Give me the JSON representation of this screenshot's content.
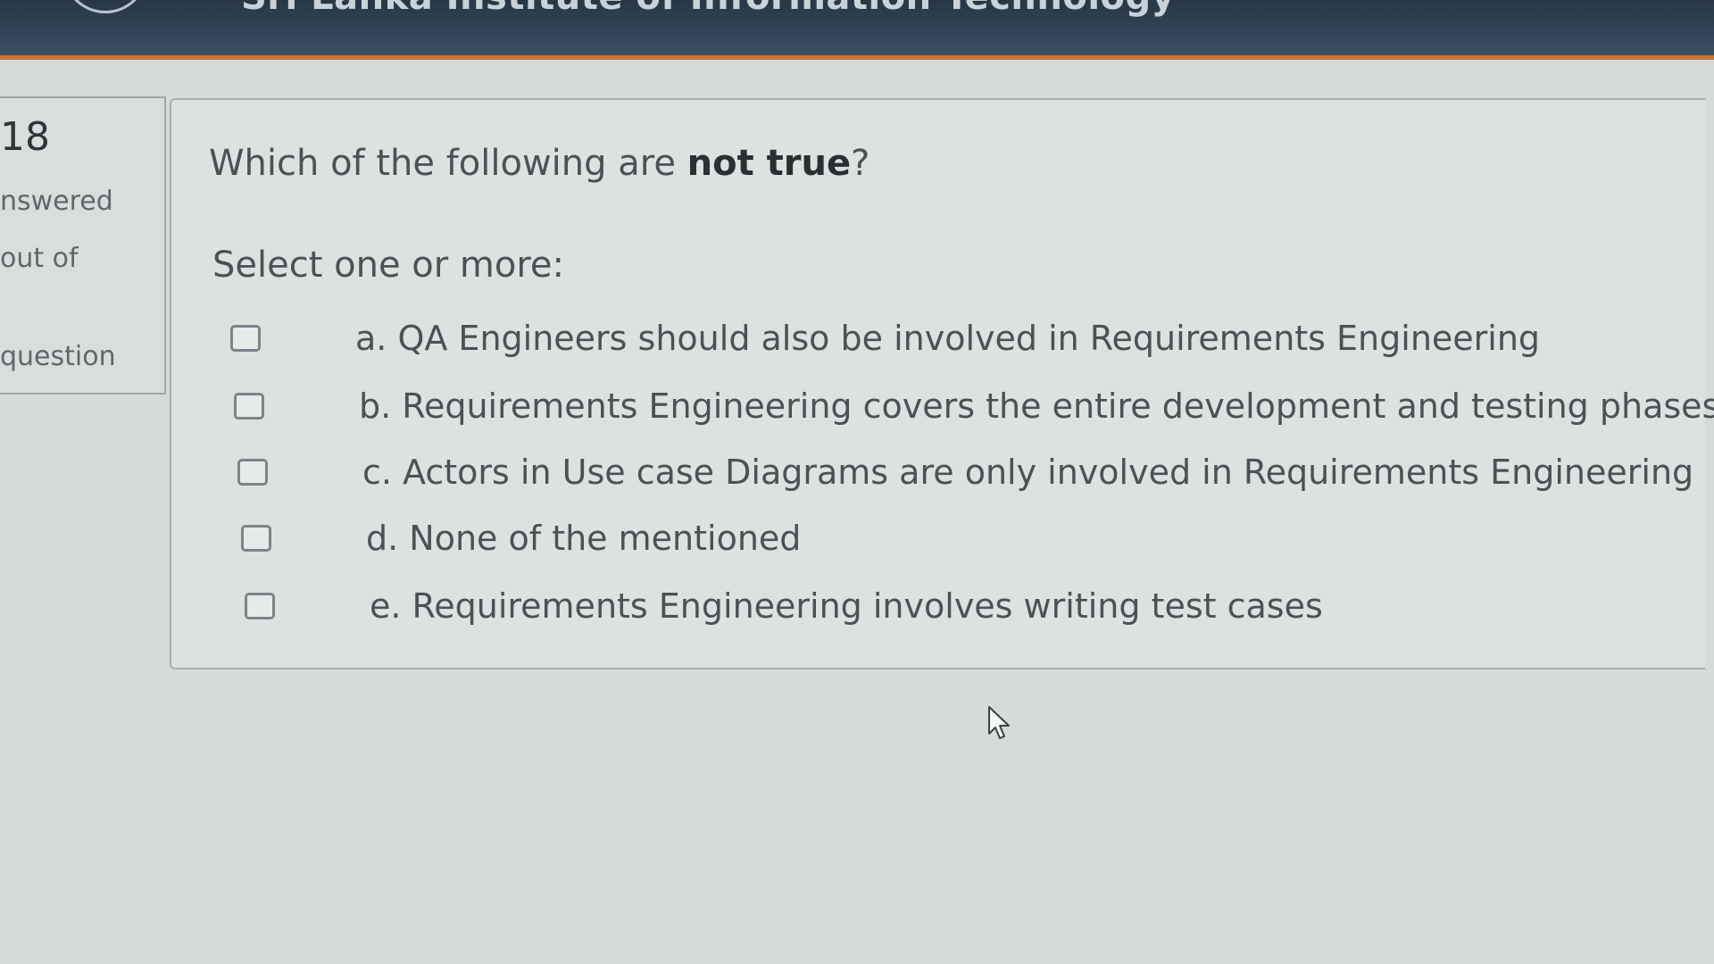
{
  "header": {
    "title": "Sri Lanka Institute of Information Technology"
  },
  "question_info": {
    "number": "18",
    "status": "nswered",
    "mark": "out of",
    "flag": "question"
  },
  "question": {
    "text_prefix": "Which of the following are ",
    "text_emphasis": "not true",
    "text_suffix": "?",
    "prompt": "Select one or more:",
    "options": [
      {
        "label": "a. QA Engineers should also be involved in Requirements Engineering",
        "checked": false
      },
      {
        "label": "b. Requirements Engineering covers the entire development and testing phases",
        "checked": false
      },
      {
        "label": "c. Actors in Use case Diagrams are only involved in Requirements Engineering",
        "checked": false
      },
      {
        "label": "d. None of the mentioned",
        "checked": false
      },
      {
        "label": "e. Requirements Engineering involves writing test cases",
        "checked": false
      }
    ]
  },
  "colors": {
    "header_bg": "#2f4254",
    "header_accent": "#d0742e",
    "page_bg": "#d6dbd9"
  },
  "icons": {
    "cursor": "mouse-pointer-icon"
  }
}
